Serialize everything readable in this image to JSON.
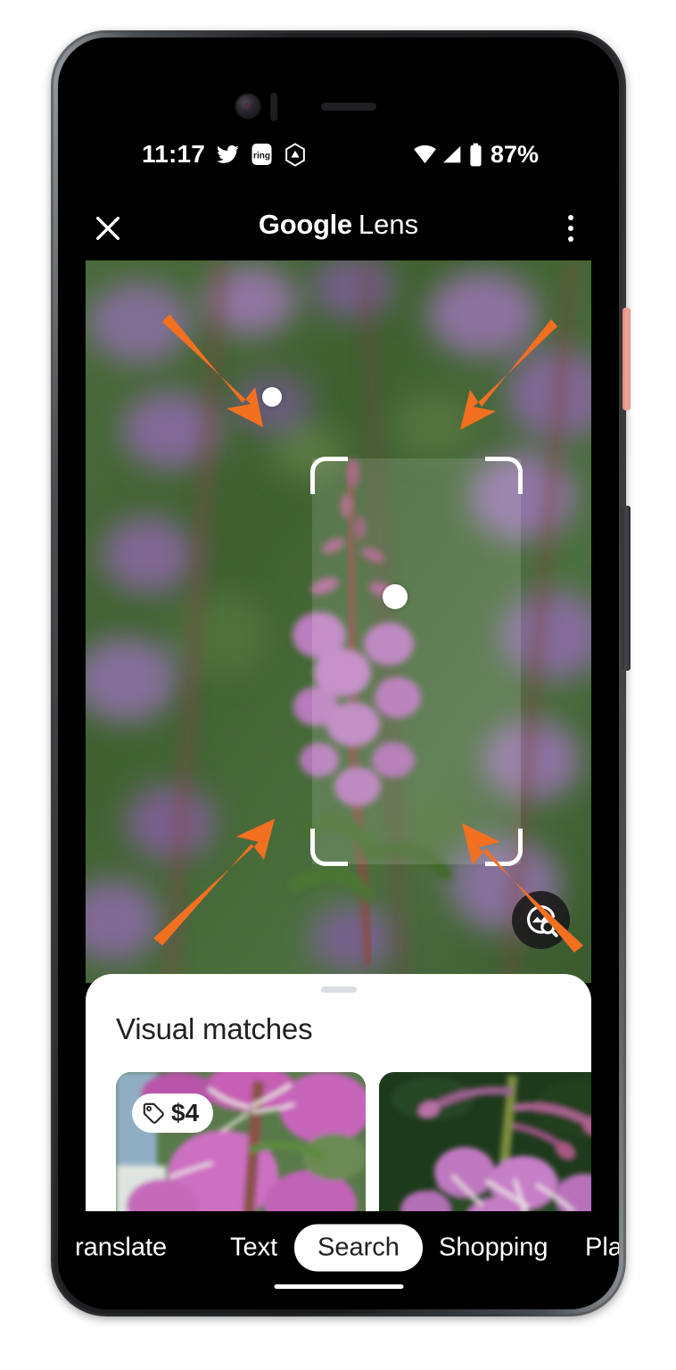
{
  "status_bar": {
    "time": "11:17",
    "notification_icons": [
      "twitter-icon",
      "ring-app-icon",
      "triangle-badge-icon"
    ],
    "wifi_icon": "wifi-icon",
    "signal_icon": "cellular-signal-icon",
    "battery_icon": "battery-icon",
    "battery_percent": "87%"
  },
  "app_bar": {
    "close_label": "×",
    "brand": "Google",
    "product": "Lens",
    "overflow_label": "More options"
  },
  "viewfinder": {
    "subject": "purple fireweed flowers",
    "fab_icon": "image-search-icon",
    "selection": {
      "corner_brackets": 4,
      "focus_dot_count": 2
    }
  },
  "annotations": {
    "arrow_color": "#F37021",
    "arrow_count": 4,
    "purpose": "highlight selection corner handles"
  },
  "results_sheet": {
    "handle": "drag-handle",
    "title": "Visual matches",
    "cards": [
      {
        "badge_icon": "price-tag-icon",
        "badge_text": "$4",
        "alt": "pink fireweed blossom close-up"
      },
      {
        "badge_icon": "",
        "badge_text": "",
        "alt": "fireweed flower with buds on dark green background"
      }
    ]
  },
  "mode_bar": {
    "items": [
      {
        "label": "ranslate",
        "selected": false
      },
      {
        "label": "Text",
        "selected": false
      },
      {
        "label": "Search",
        "selected": true
      },
      {
        "label": "Shopping",
        "selected": false
      },
      {
        "label": "Pla",
        "selected": false
      }
    ]
  },
  "navigation": {
    "gesture_bar": "home-gesture-bar"
  },
  "hardware": {
    "power_button": "power-button",
    "volume_rocker": "volume-rocker"
  },
  "colors": {
    "accent_orange": "#F37021",
    "sheet_background": "#FFFFFF",
    "app_background": "#000000",
    "title_text": "#202124"
  }
}
